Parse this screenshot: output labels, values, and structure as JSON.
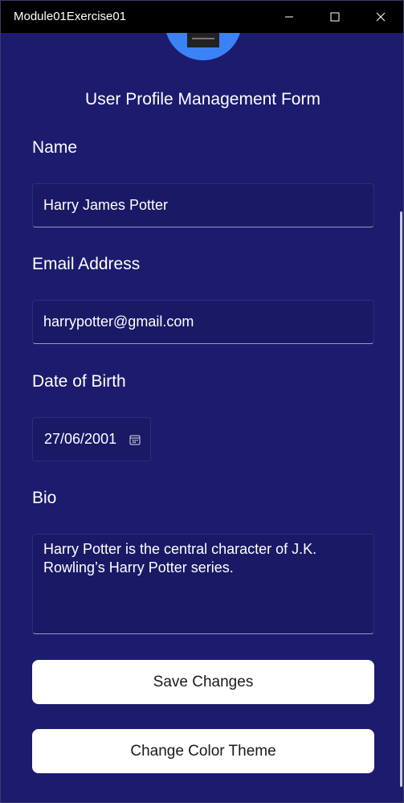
{
  "window": {
    "title": "Module01Exercise01"
  },
  "form": {
    "title": "User Profile Management Form",
    "name_label": "Name",
    "name_value": "Harry James Potter",
    "email_label": "Email Address",
    "email_value": "harrypotter@gmail.com",
    "dob_label": "Date of Birth",
    "dob_value": "27/06/2001",
    "bio_label": "Bio",
    "bio_value": "Harry Potter is the central character of J.K. Rowling’s Harry Potter series.",
    "save_label": "Save Changes",
    "theme_label": "Change Color Theme"
  },
  "colors": {
    "background": "#1c1b6e",
    "avatar": "#3b82f6",
    "button": "#ffffff"
  },
  "icons": {
    "minimize": "minimize-icon",
    "maximize": "maximize-icon",
    "close": "close-icon",
    "calendar": "calendar-icon"
  }
}
